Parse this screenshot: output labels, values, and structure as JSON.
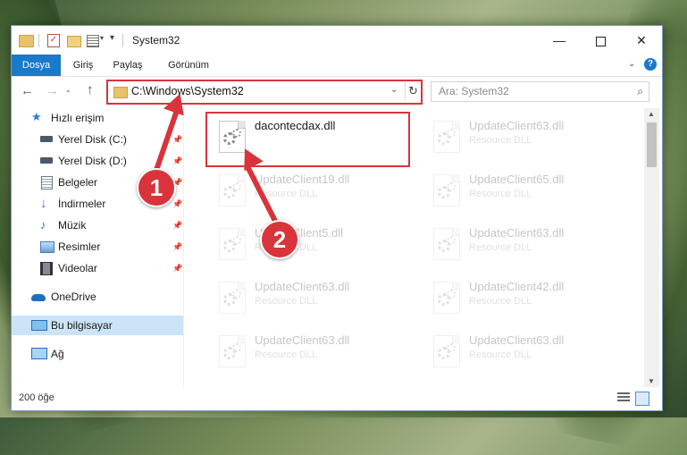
{
  "window": {
    "title": "System32",
    "minimize_glyph": "—",
    "close_glyph": "✕"
  },
  "quick_access": {
    "check_glyph": "✓",
    "dropdown_glyph": "▾",
    "arrow_glyph": "▾"
  },
  "ribbon": {
    "tabs": [
      "Dosya",
      "Giriş",
      "Paylaş",
      "Görünüm"
    ],
    "chevron_glyph": "⌄",
    "help_glyph": "?"
  },
  "navigation": {
    "back_glyph": "←",
    "forward_glyph": "→",
    "history_glyph": "⌄",
    "up_glyph": "↑",
    "address": "C:\\Windows\\System32",
    "address_dropdown_glyph": "⌄",
    "refresh_glyph": "↻",
    "search_placeholder": "Ara: System32",
    "search_glyph": "⌕"
  },
  "sidebar": {
    "pin_glyph": "📌",
    "items": [
      {
        "label": "Hızlı erişim",
        "icon": "star-icon",
        "pinned": false
      },
      {
        "label": "Yerel Disk (C:)",
        "icon": "drive-c-icon",
        "pinned": true
      },
      {
        "label": "Yerel Disk (D:)",
        "icon": "drive-d-icon",
        "pinned": true
      },
      {
        "label": "Belgeler",
        "icon": "documents-icon",
        "pinned": true
      },
      {
        "label": "İndirmeler",
        "icon": "downloads-icon",
        "pinned": true
      },
      {
        "label": "Müzik",
        "icon": "music-icon",
        "pinned": true
      },
      {
        "label": "Resimler",
        "icon": "pictures-icon",
        "pinned": true
      },
      {
        "label": "Videolar",
        "icon": "videos-icon",
        "pinned": true
      },
      {
        "label": "OneDrive",
        "icon": "onedrive-icon",
        "pinned": false
      },
      {
        "label": "Bu bilgisayar",
        "icon": "this-pc-icon",
        "pinned": false,
        "selected": true
      },
      {
        "label": "Ağ",
        "icon": "network-icon",
        "pinned": false
      }
    ]
  },
  "files": {
    "column1": [
      {
        "name": "dacontecdax.dll",
        "type": "",
        "highlighted": true
      },
      {
        "name": "UpdateClient19.dll",
        "type": "Resource DLL"
      },
      {
        "name": "UpdateClient5.dll",
        "type": "Resource DLL"
      },
      {
        "name": "UpdateClient63.dll",
        "type": "Resource DLL"
      },
      {
        "name": "UpdateClient63.dll",
        "type": "Resource DLL"
      }
    ],
    "column2": [
      {
        "name": "UpdateClient63.dll",
        "type": "Resource DLL"
      },
      {
        "name": "UpdateClient65.dll",
        "type": "Resource DLL"
      },
      {
        "name": "UpdateClient63.dll",
        "type": "Resource DLL"
      },
      {
        "name": "UpdateClient42.dll",
        "type": "Resource DLL"
      },
      {
        "name": "UpdateClient63.dll",
        "type": "Resource DLL"
      }
    ]
  },
  "status": {
    "item_count": "200 öğe"
  },
  "annotations": {
    "badge1": "1",
    "badge2": "2",
    "color": "#d9343b"
  },
  "colors": {
    "accent": "#1979ca",
    "selection": "#cce4f7",
    "highlight": "#d9343b"
  },
  "scrollbar": {
    "up_glyph": "▲",
    "down_glyph": "▼"
  }
}
